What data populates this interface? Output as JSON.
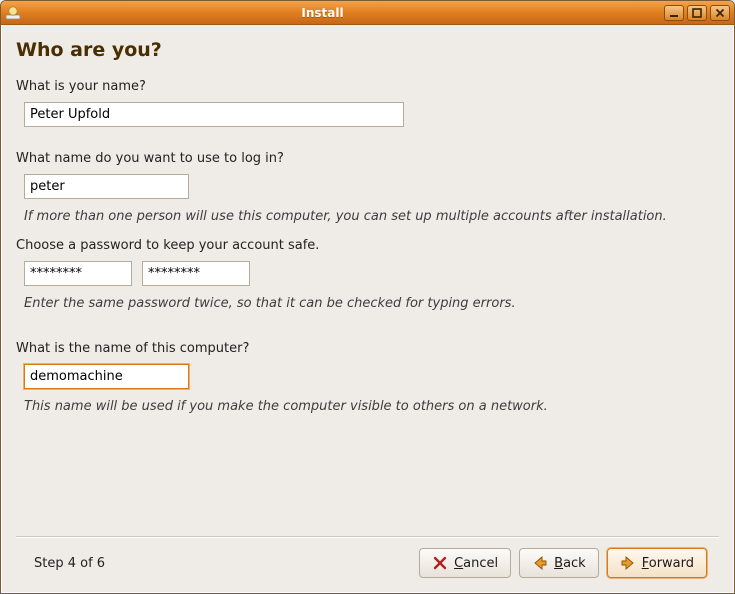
{
  "window": {
    "title": "Install"
  },
  "heading": "Who are you?",
  "name": {
    "label": "What is your name?",
    "value": "Peter Upfold"
  },
  "login": {
    "label": "What name do you want to use to log in?",
    "value": "peter",
    "hint": "If more than one person will use this computer, you can set up multiple accounts after installation."
  },
  "password": {
    "label": "Choose a password to keep your account safe.",
    "value1": "********",
    "value2": "********",
    "hint": "Enter the same password twice, so that it can be checked for typing errors."
  },
  "hostname": {
    "label": "What is the name of this computer?",
    "value": "demomachine",
    "hint": "This name will be used if you make the computer visible to others on a network."
  },
  "footer": {
    "step": "Step 4 of 6",
    "cancel": "Cancel",
    "back": "Back",
    "forward": "Forward"
  }
}
